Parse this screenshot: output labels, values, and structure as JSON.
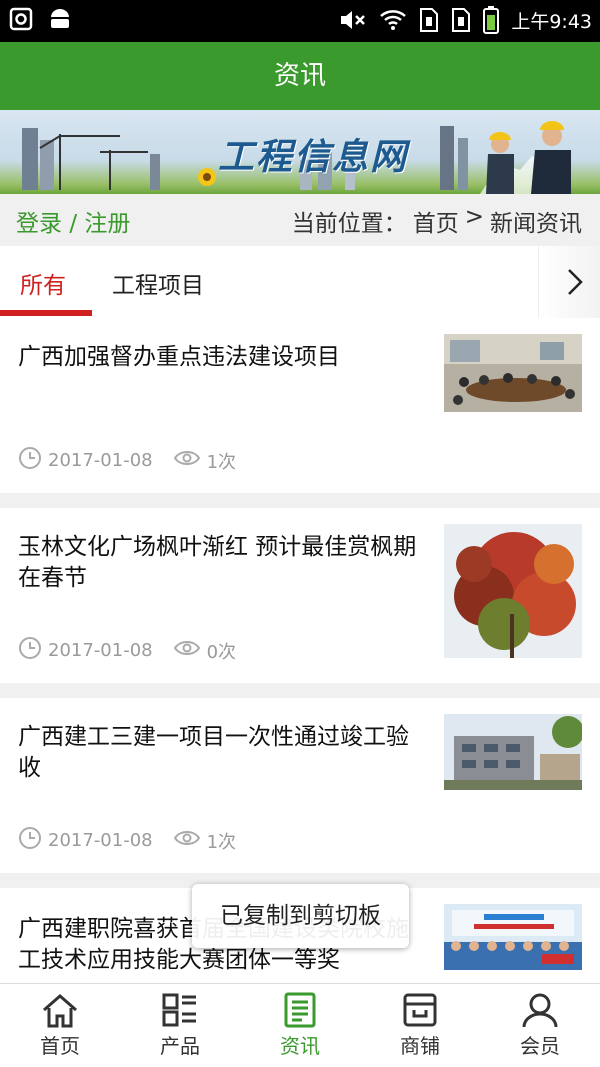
{
  "status_bar": {
    "time": "上午9:43"
  },
  "header": {
    "title": "资讯"
  },
  "banner": {
    "title": "工程信息网"
  },
  "location_bar": {
    "login": "登录",
    "separator": "/",
    "register": "注册",
    "prefix": "当前位置：",
    "home": "首页",
    "arrow": ">",
    "current": "新闻资讯"
  },
  "tabs": [
    {
      "label": "所有",
      "active": true
    },
    {
      "label": "工程项目",
      "active": false
    }
  ],
  "articles": [
    {
      "title": "广西加强督办重点违法建设项目",
      "date": "2017-01-08",
      "views": "1次"
    },
    {
      "title": "玉林文化广场枫叶渐红 预计最佳赏枫期在春节",
      "date": "2017-01-08",
      "views": "0次"
    },
    {
      "title": "广西建工三建一项目一次性通过竣工验收",
      "date": "2017-01-08",
      "views": "1次"
    },
    {
      "title": "广西建职院喜获首届全国建设类院校施工技术应用技能大赛团体一等奖"
    }
  ],
  "toast": "已复制到剪切板",
  "bottom_nav": [
    {
      "label": "首页",
      "icon": "home-icon",
      "active": false
    },
    {
      "label": "产品",
      "icon": "product-grid-icon",
      "active": false
    },
    {
      "label": "资讯",
      "icon": "news-icon",
      "active": true
    },
    {
      "label": "商铺",
      "icon": "shop-icon",
      "active": false
    },
    {
      "label": "会员",
      "icon": "member-icon",
      "active": false
    }
  ],
  "colors": {
    "brand_green": "#3a9a2d",
    "active_red": "#d02020",
    "meta_gray": "#9a9a9a"
  }
}
